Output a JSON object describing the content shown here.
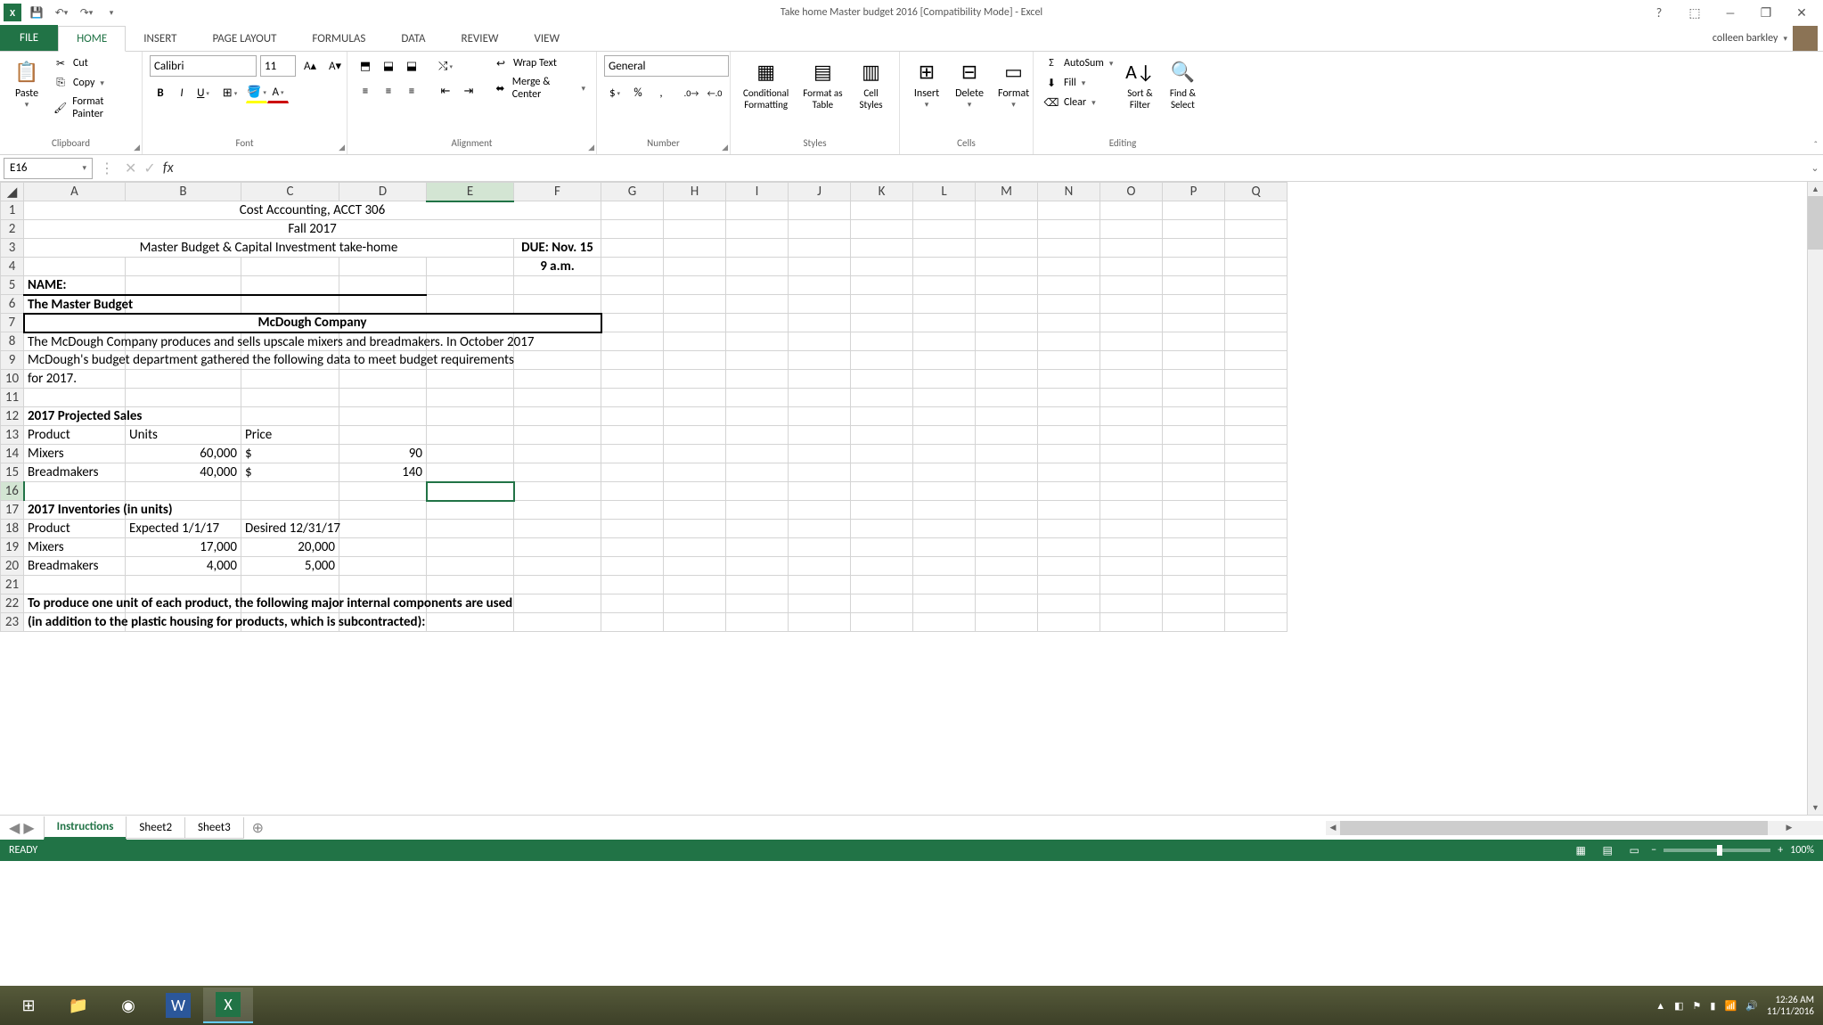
{
  "titlebar": {
    "title": "Take home Master budget 2016  [Compatibility Mode] - Excel",
    "help": "?"
  },
  "account": {
    "name": "colleen barkley"
  },
  "tabs": {
    "file": "FILE",
    "list": [
      "HOME",
      "INSERT",
      "PAGE LAYOUT",
      "FORMULAS",
      "DATA",
      "REVIEW",
      "VIEW"
    ],
    "active": "HOME"
  },
  "ribbon": {
    "clipboard": {
      "paste": "Paste",
      "cut": "Cut",
      "copy": "Copy",
      "format_painter": "Format Painter",
      "label": "Clipboard"
    },
    "font": {
      "name": "Calibri",
      "size": "11",
      "label": "Font"
    },
    "alignment": {
      "wrap": "Wrap Text",
      "merge": "Merge & Center",
      "label": "Alignment"
    },
    "number": {
      "format": "General",
      "label": "Number"
    },
    "styles": {
      "cond": "Conditional\nFormatting",
      "table": "Format as\nTable",
      "cell": "Cell\nStyles",
      "label": "Styles"
    },
    "cells": {
      "insert": "Insert",
      "delete": "Delete",
      "format": "Format",
      "label": "Cells"
    },
    "editing": {
      "autosum": "AutoSum",
      "fill": "Fill",
      "clear": "Clear",
      "sort": "Sort &\nFilter",
      "find": "Find &\nSelect",
      "label": "Editing"
    }
  },
  "fxbar": {
    "cellref": "E16",
    "formula": ""
  },
  "columns": [
    "A",
    "B",
    "C",
    "D",
    "E",
    "F",
    "G",
    "H",
    "I",
    "J",
    "K",
    "L",
    "M",
    "N",
    "O",
    "P",
    "Q"
  ],
  "cells": {
    "r1": {
      "title": "Cost Accounting, ACCT 306"
    },
    "r2": {
      "title": "Fall 2017"
    },
    "r3": {
      "title": "Master Budget & Capital Investment take-home",
      "due": "DUE: Nov. 15"
    },
    "r4": {
      "due": "9 a.m."
    },
    "r5": {
      "a": "NAME:"
    },
    "r6": {
      "a": "The Master Budget"
    },
    "r7": {
      "title": "McDough Company"
    },
    "r8": {
      "a": "The McDough Company produces and sells upscale mixers and breadmakers.  In October 2017"
    },
    "r9": {
      "a": "McDough's budget department gathered the following data to meet budget requirements"
    },
    "r10": {
      "a": "for 2017."
    },
    "r12": {
      "a": "2017 Projected Sales"
    },
    "r13": {
      "a": "Product",
      "b": "Units",
      "c": "Price"
    },
    "r14": {
      "a": "Mixers",
      "b": "60,000",
      "c_sym": "$",
      "d": "90"
    },
    "r15": {
      "a": "Breadmakers",
      "b": "40,000",
      "c_sym": "$",
      "d": "140"
    },
    "r17": {
      "a": "2017 Inventories (in units)"
    },
    "r18": {
      "a": "Product",
      "b": "Expected 1/1/17",
      "c": "Desired 12/31/17"
    },
    "r19": {
      "a": "Mixers",
      "b": "17,000",
      "c": "20,000"
    },
    "r20": {
      "a": "Breadmakers",
      "b": "4,000",
      "c": "5,000"
    },
    "r22": {
      "a": "To produce one unit of each product, the following major internal components are used"
    },
    "r23": {
      "a": "(in addition to the plastic housing for products, which is subcontracted):"
    }
  },
  "sheets": {
    "tabs": [
      "Instructions",
      "Sheet2",
      "Sheet3"
    ],
    "active": "Instructions"
  },
  "statusbar": {
    "ready": "READY",
    "zoom": "100%"
  },
  "taskbar": {
    "time": "12:26 AM",
    "date": "11/11/2016"
  }
}
